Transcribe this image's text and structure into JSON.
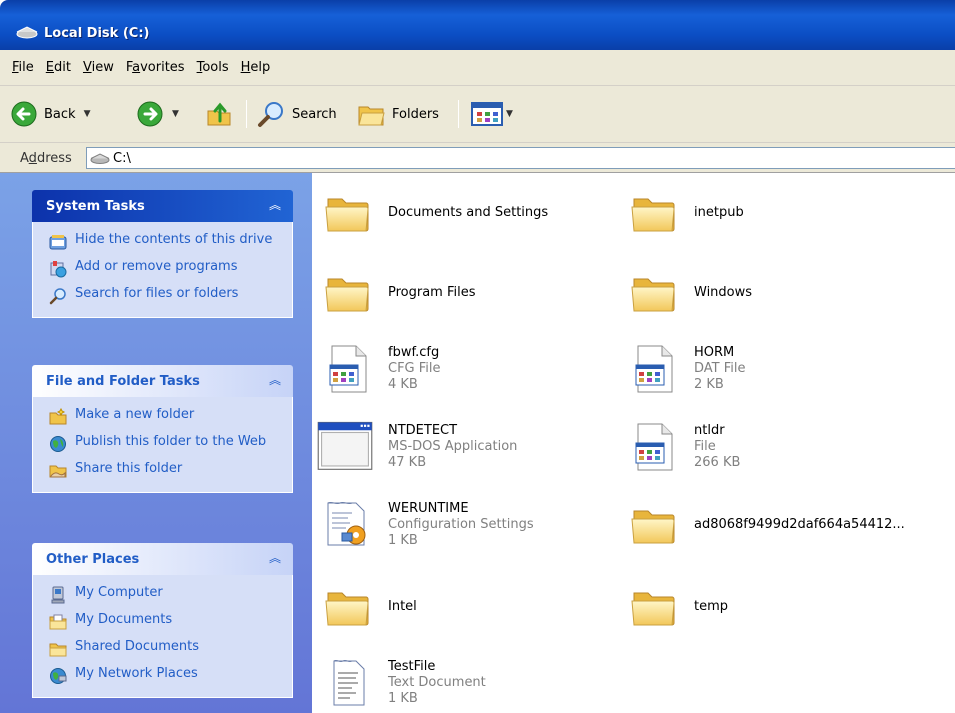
{
  "window": {
    "title": "Local Disk (C:)"
  },
  "menu": [
    {
      "label": "File",
      "accel": "F",
      "rest": "ile"
    },
    {
      "label": "Edit",
      "accel": "E",
      "rest": "dit"
    },
    {
      "label": "View",
      "accel": "V",
      "rest": "iew"
    },
    {
      "label": "Favorites",
      "pre": "F",
      "accel": "a",
      "rest": "vorites"
    },
    {
      "label": "Tools",
      "accel": "T",
      "rest": "ools"
    },
    {
      "label": "Help",
      "accel": "H",
      "rest": "elp"
    }
  ],
  "toolbar": {
    "back_label": "Back",
    "search_label": "Search",
    "folders_label": "Folders"
  },
  "address": {
    "label_pre": "A",
    "label_accel": "d",
    "label_rest": "dress",
    "value": "C:\\"
  },
  "sidebar": {
    "system_tasks": {
      "title": "System Tasks",
      "items": [
        {
          "label": "Hide the contents of this drive",
          "icon": "hide-contents-icon"
        },
        {
          "label": "Add or remove programs",
          "icon": "add-remove-programs-icon"
        },
        {
          "label": "Search for files or folders",
          "icon": "search-icon"
        }
      ]
    },
    "file_folder_tasks": {
      "title": "File and Folder Tasks",
      "items": [
        {
          "label": "Make a new folder",
          "icon": "new-folder-icon"
        },
        {
          "label": "Publish this folder to the Web",
          "icon": "publish-web-icon"
        },
        {
          "label": "Share this folder",
          "icon": "share-folder-icon"
        }
      ]
    },
    "other_places": {
      "title": "Other Places",
      "items": [
        {
          "label": "My Computer",
          "icon": "my-computer-icon"
        },
        {
          "label": "My Documents",
          "icon": "my-documents-icon"
        },
        {
          "label": "Shared Documents",
          "icon": "shared-documents-icon"
        },
        {
          "label": "My Network Places",
          "icon": "network-places-icon"
        }
      ]
    }
  },
  "files": [
    {
      "name": "Documents and Settings",
      "type": "",
      "size": "",
      "icon": "folder-icon"
    },
    {
      "name": "inetpub",
      "type": "",
      "size": "",
      "icon": "folder-icon"
    },
    {
      "name": "Program Files",
      "type": "",
      "size": "",
      "icon": "folder-icon"
    },
    {
      "name": "Windows",
      "type": "",
      "size": "",
      "icon": "folder-icon"
    },
    {
      "name": "fbwf.cfg",
      "type": "CFG File",
      "size": "4 KB",
      "icon": "generic-file-icon"
    },
    {
      "name": "HORM",
      "type": "DAT File",
      "size": "2 KB",
      "icon": "generic-file-icon"
    },
    {
      "name": "NTDETECT",
      "type": "MS-DOS Application",
      "size": "47 KB",
      "icon": "msdos-app-icon"
    },
    {
      "name": "ntldr",
      "type": "File",
      "size": "266 KB",
      "icon": "generic-file-icon"
    },
    {
      "name": "WERUNTIME",
      "type": "Configuration Settings",
      "size": "1 KB",
      "icon": "config-settings-icon"
    },
    {
      "name": "ad8068f9499d2daf664a54412...",
      "type": "",
      "size": "",
      "icon": "folder-icon"
    },
    {
      "name": "Intel",
      "type": "",
      "size": "",
      "icon": "folder-icon"
    },
    {
      "name": "temp",
      "type": "",
      "size": "",
      "icon": "folder-icon"
    },
    {
      "name": "TestFile",
      "type": "Text Document",
      "size": "1 KB",
      "icon": "text-document-icon"
    }
  ],
  "colors": {
    "title_bar": "#0a3fa8",
    "sidebar_bg": "#6375d6",
    "task_link": "#215dc6",
    "chrome": "#ece9d8"
  }
}
